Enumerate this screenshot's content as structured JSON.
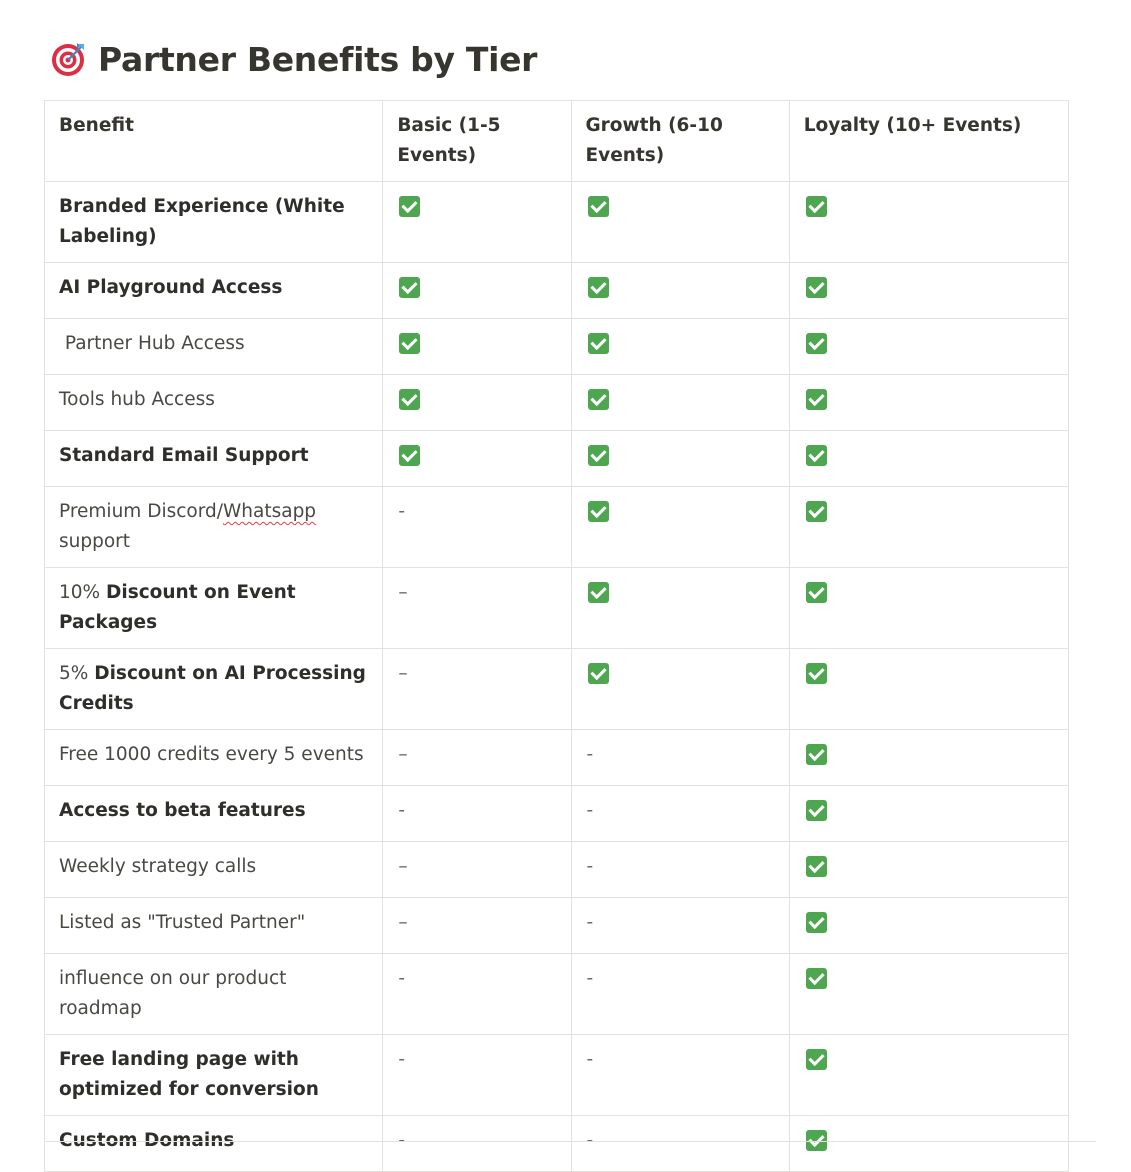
{
  "title": {
    "icon": "direct-hit-target-icon",
    "text": "Partner Benefits by Tier"
  },
  "table": {
    "headers": [
      "Benefit",
      "Basic (1-5 Events)",
      "Growth (6-10 Events)",
      "Loyalty (10+ Events)"
    ],
    "rows": [
      {
        "prefix": "",
        "benefit": "Branded Experience (White Labeling)",
        "style": "bold",
        "basic": "check",
        "growth": "check",
        "loyalty": "check"
      },
      {
        "prefix": "",
        "benefit": "AI Playground Access",
        "style": "bold",
        "basic": "check",
        "growth": "check",
        "loyalty": "check"
      },
      {
        "prefix": "",
        "benefit": " Partner Hub Access",
        "style": "light",
        "basic": "check",
        "growth": "check",
        "loyalty": "check"
      },
      {
        "prefix": "",
        "benefit": "Tools hub Access",
        "style": "light",
        "basic": "check",
        "growth": "check",
        "loyalty": "check"
      },
      {
        "prefix": "",
        "benefit": "Standard Email Support",
        "style": "bold",
        "basic": "check",
        "growth": "check",
        "loyalty": "check"
      },
      {
        "prefix": "",
        "benefit": "Premium Discord/Whatsapp support",
        "style": "light",
        "basic": "-",
        "growth": "check",
        "loyalty": "check"
      },
      {
        "prefix": "10% ",
        "benefit": "Discount on Event Packages",
        "style": "mixed",
        "basic": "–",
        "growth": "check",
        "loyalty": "check"
      },
      {
        "prefix": "5% ",
        "benefit": "Discount on AI Processing Credits",
        "style": "mixed",
        "basic": "–",
        "growth": "check",
        "loyalty": "check"
      },
      {
        "prefix": "",
        "benefit": "Free 1000 credits every 5 events",
        "style": "light",
        "basic": "–",
        "growth": "-",
        "loyalty": "check"
      },
      {
        "prefix": "",
        "benefit": "Access to beta features",
        "style": "bold",
        "basic": "-",
        "growth": "-",
        "loyalty": "check"
      },
      {
        "prefix": "",
        "benefit": "Weekly strategy calls",
        "style": "light",
        "basic": "–",
        "growth": "-",
        "loyalty": "check"
      },
      {
        "prefix": "",
        "benefit": "Listed as \"Trusted Partner\"",
        "style": "light",
        "basic": "–",
        "growth": "-",
        "loyalty": "check"
      },
      {
        "prefix": "",
        "benefit": "influence on our product roadmap",
        "style": "light",
        "basic": "-",
        "growth": "-",
        "loyalty": "check"
      },
      {
        "prefix": "",
        "benefit": "Free landing page with optimized for conversion",
        "style": "bold",
        "basic": "-",
        "growth": "-",
        "loyalty": "check"
      },
      {
        "prefix": "",
        "benefit": "Custom Domains",
        "style": "bold",
        "basic": "-",
        "growth": "-",
        "loyalty": "check"
      }
    ]
  },
  "colors": {
    "check_green": "#4fa650",
    "border": "#e3e2e0",
    "text": "#37352f",
    "spellcheck": "#e03e3e"
  }
}
